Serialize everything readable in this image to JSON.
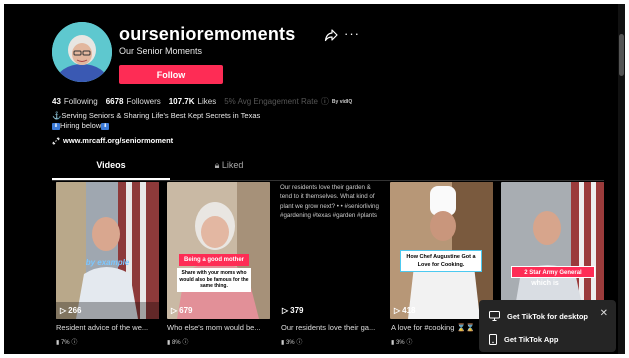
{
  "profile": {
    "username": "oursenioremoments",
    "nickname": "Our Senior Moments",
    "follow_label": "Follow",
    "share_icon": "share-icon",
    "more_label": "···"
  },
  "stats": {
    "following_count": "43",
    "following_label": "Following",
    "followers_count": "6678",
    "followers_label": "Followers",
    "likes_count": "107.7K",
    "likes_label": "Likes",
    "engagement_text": "5% Avg Engagement Rate",
    "info_icon": "ⓘ",
    "byvidiq": "By vidIQ"
  },
  "bio": {
    "line1": "⚓Serving Seniors & Sharing Life's Best Kept Secrets in Texas",
    "badge": "⬇",
    "line2_text": "Hiring below",
    "link": "www.mrcaff.org/seniormoment"
  },
  "tabs": {
    "videos": "Videos",
    "liked": "Liked"
  },
  "videos": [
    {
      "views": "266",
      "caption": "Resident advice of the we...",
      "engagement": "7%",
      "overlay": "by example"
    },
    {
      "views": "679",
      "caption": "Who else's mom would be...",
      "engagement": "8%",
      "overlay_title": "Being a good mother",
      "overlay_text": "Share with your moms who would also be famous for the same thing."
    },
    {
      "views": "379",
      "caption": "Our residents love their ga...",
      "engagement": "3%",
      "alt_text": "Our residents love their garden & tend to it themselves. What kind of plant we grow next? • • #seniorliving #gardening #texas #garden #plants"
    },
    {
      "views": "418",
      "caption": "A love for #cooking ⌛⌛",
      "engagement": "3%",
      "overlay": "How Chef Augustine Got a Love for Cooking."
    },
    {
      "views": "",
      "caption": "",
      "engagement": "",
      "overlay": "2 Star Army General",
      "overlay_sub": "which is"
    }
  ],
  "popup": {
    "desktop_label": "Get TikTok for desktop",
    "app_label": "Get TikTok App",
    "close": "✕"
  },
  "colors": {
    "accent": "#fe2c55",
    "background": "#000000"
  }
}
